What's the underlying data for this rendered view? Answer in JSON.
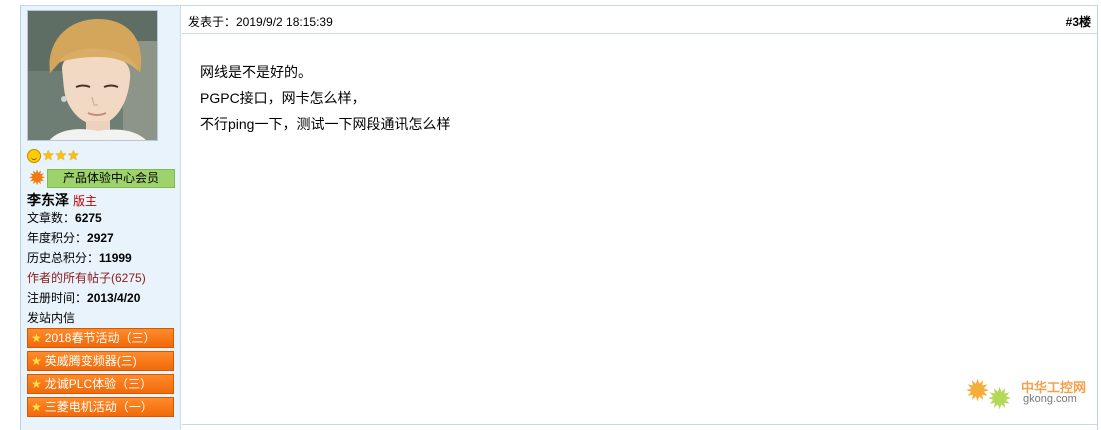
{
  "post": {
    "date": "发表于：2019/9/2 18:15:39",
    "floor": "#3楼",
    "lines": [
      "网线是不是好的。",
      "PGPC接口，网卡怎么样，",
      "不行ping一下，测试一下网段通讯怎么样"
    ]
  },
  "author": {
    "rank_label": "产品体验中心会员",
    "name": "李东泽",
    "role": "版主",
    "stats": {
      "posts_label": "文章数：",
      "posts_value": "6275",
      "annual_label": "年度积分：",
      "annual_value": "2927",
      "total_label": "历史总积分：",
      "total_value": "11999",
      "all_posts_link": "作者的所有帖子(6275)",
      "register_label": "注册时间：",
      "register_value": "2013/4/20",
      "message_link": "发站内信"
    },
    "awards": [
      "2018春节活动（三）",
      "英威腾变频器(三)",
      "龙诚PLC体验（三）",
      "三菱电机活动（一）"
    ]
  },
  "watermark": {
    "cn": "中华工控网",
    "en": "gkong.com"
  },
  "colors": {
    "sidebar_bg": "#e8f3fc",
    "rank_badge": "#9ed36b",
    "award_bg": "#f06a0a",
    "role_red": "#c00000"
  }
}
